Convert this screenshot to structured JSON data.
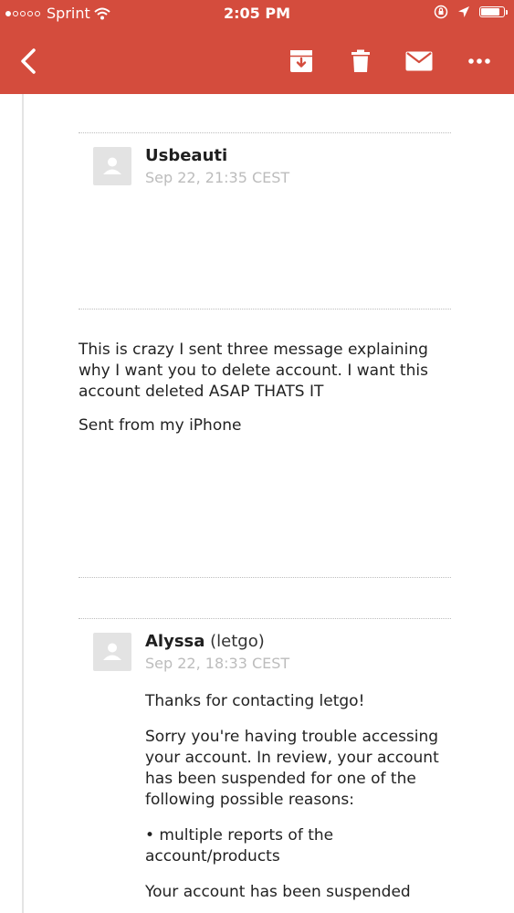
{
  "status_bar": {
    "carrier": "Sprint",
    "time": "2:05 PM",
    "battery_level": 0.85
  },
  "toolbar": {
    "back_icon": "chevron-left-icon",
    "actions": [
      "archive-icon",
      "trash-icon",
      "mark-unread-icon",
      "more-icon"
    ]
  },
  "messages": [
    {
      "sender": "Usbeauti",
      "org": "",
      "date": "Sep 22, 21:35 CEST",
      "body": [
        "This is crazy I sent three message explaining why I want you to delete account. I want this account deleted ASAP THATS IT",
        "Sent from my iPhone"
      ]
    },
    {
      "sender": "Alyssa",
      "org": "(letgo)",
      "date": "Sep 22, 18:33 CEST",
      "body": [
        "Thanks for contacting letgo!",
        "Sorry you're having trouble accessing your account. In review, your account has been suspended for one of the following possible reasons:",
        "• multiple reports of the account/products",
        "Your account has been suspended"
      ]
    }
  ],
  "colors": {
    "header": "#d44c3d",
    "date_text": "#bcbcbc",
    "separator": "#bdbdbd"
  }
}
